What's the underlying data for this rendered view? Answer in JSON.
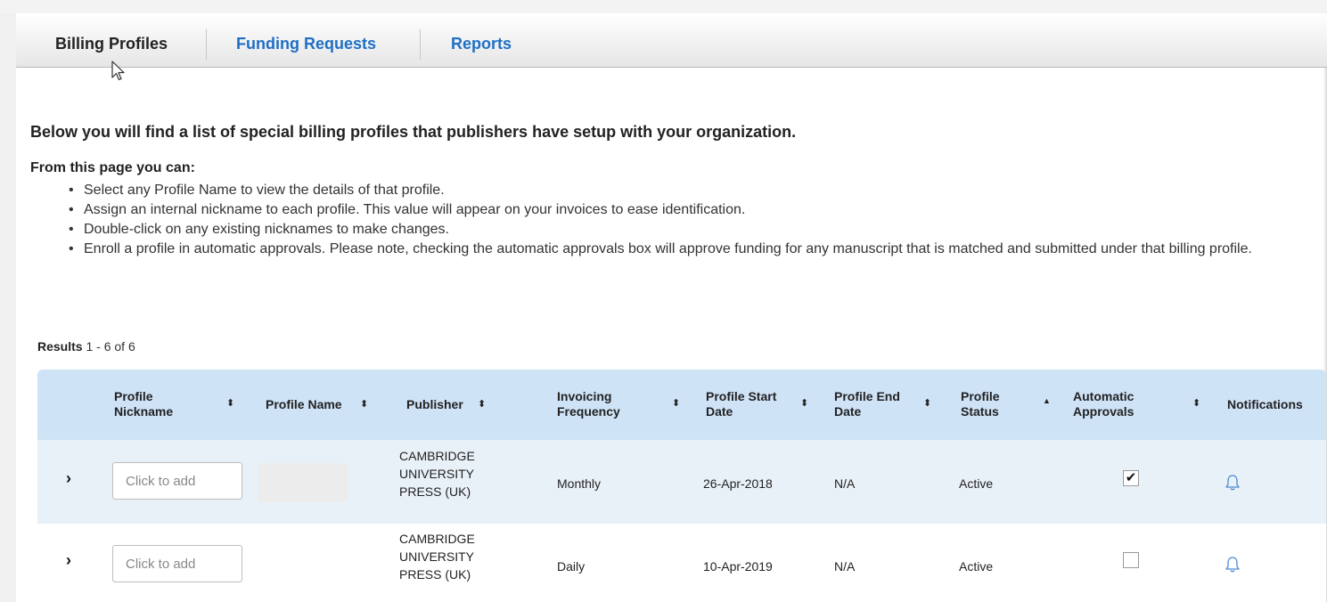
{
  "tabs": [
    {
      "label": "Billing Profiles",
      "active": true
    },
    {
      "label": "Funding Requests",
      "active": false
    },
    {
      "label": "Reports",
      "active": false
    }
  ],
  "intro": "Below you will find a list of special billing profiles that publishers have setup with your organization.",
  "subheading": "From this page you can:",
  "bullets": [
    "Select any Profile Name to view the details of that profile.",
    "Assign an internal nickname to each profile. This value will appear on your invoices to ease identification.",
    "Double-click on any existing nicknames to make changes.",
    "Enroll a profile in automatic approvals. Please note, checking the automatic approvals box will approve funding for any manuscript that is matched and submitted under that billing profile."
  ],
  "results": {
    "label": "Results",
    "range": "1 - 6 of 6"
  },
  "columns": {
    "nickname": {
      "line1": "Profile",
      "line2": "Nickname"
    },
    "name": "Profile Name",
    "publisher": "Publisher",
    "frequency": {
      "line1": "Invoicing",
      "line2": "Frequency"
    },
    "start": {
      "line1": "Profile Start",
      "line2": "Date"
    },
    "end": {
      "line1": "Profile End",
      "line2": "Date"
    },
    "status": {
      "line1": "Profile",
      "line2": "Status"
    },
    "approvals": {
      "line1": "Automatic",
      "line2": "Approvals"
    },
    "notifications": "Notifications"
  },
  "sort_icons": {
    "both": "⬍",
    "up": "▲"
  },
  "expander_icon": "›",
  "rows": [
    {
      "nickname_placeholder": "Click to add",
      "publisher": {
        "line1": "CAMBRIDGE",
        "line2": "UNIVERSITY",
        "line3": "PRESS (UK)"
      },
      "frequency": "Monthly",
      "start": "26-Apr-2018",
      "end": "N/A",
      "status": "Active",
      "approval_mark": "✔",
      "approved": true
    },
    {
      "nickname_placeholder": "Click to add",
      "publisher": {
        "line1": "CAMBRIDGE",
        "line2": "UNIVERSITY",
        "line3": "PRESS (UK)"
      },
      "frequency": "Daily",
      "start": "10-Apr-2019",
      "end": "N/A",
      "status": "Active",
      "approval_mark": "",
      "approved": false
    }
  ],
  "colors": {
    "link": "#1f6fc5",
    "header_bg": "#cfe3f7",
    "row_alt_bg": "#e9f1f8",
    "bell": "#4a8ad4"
  }
}
